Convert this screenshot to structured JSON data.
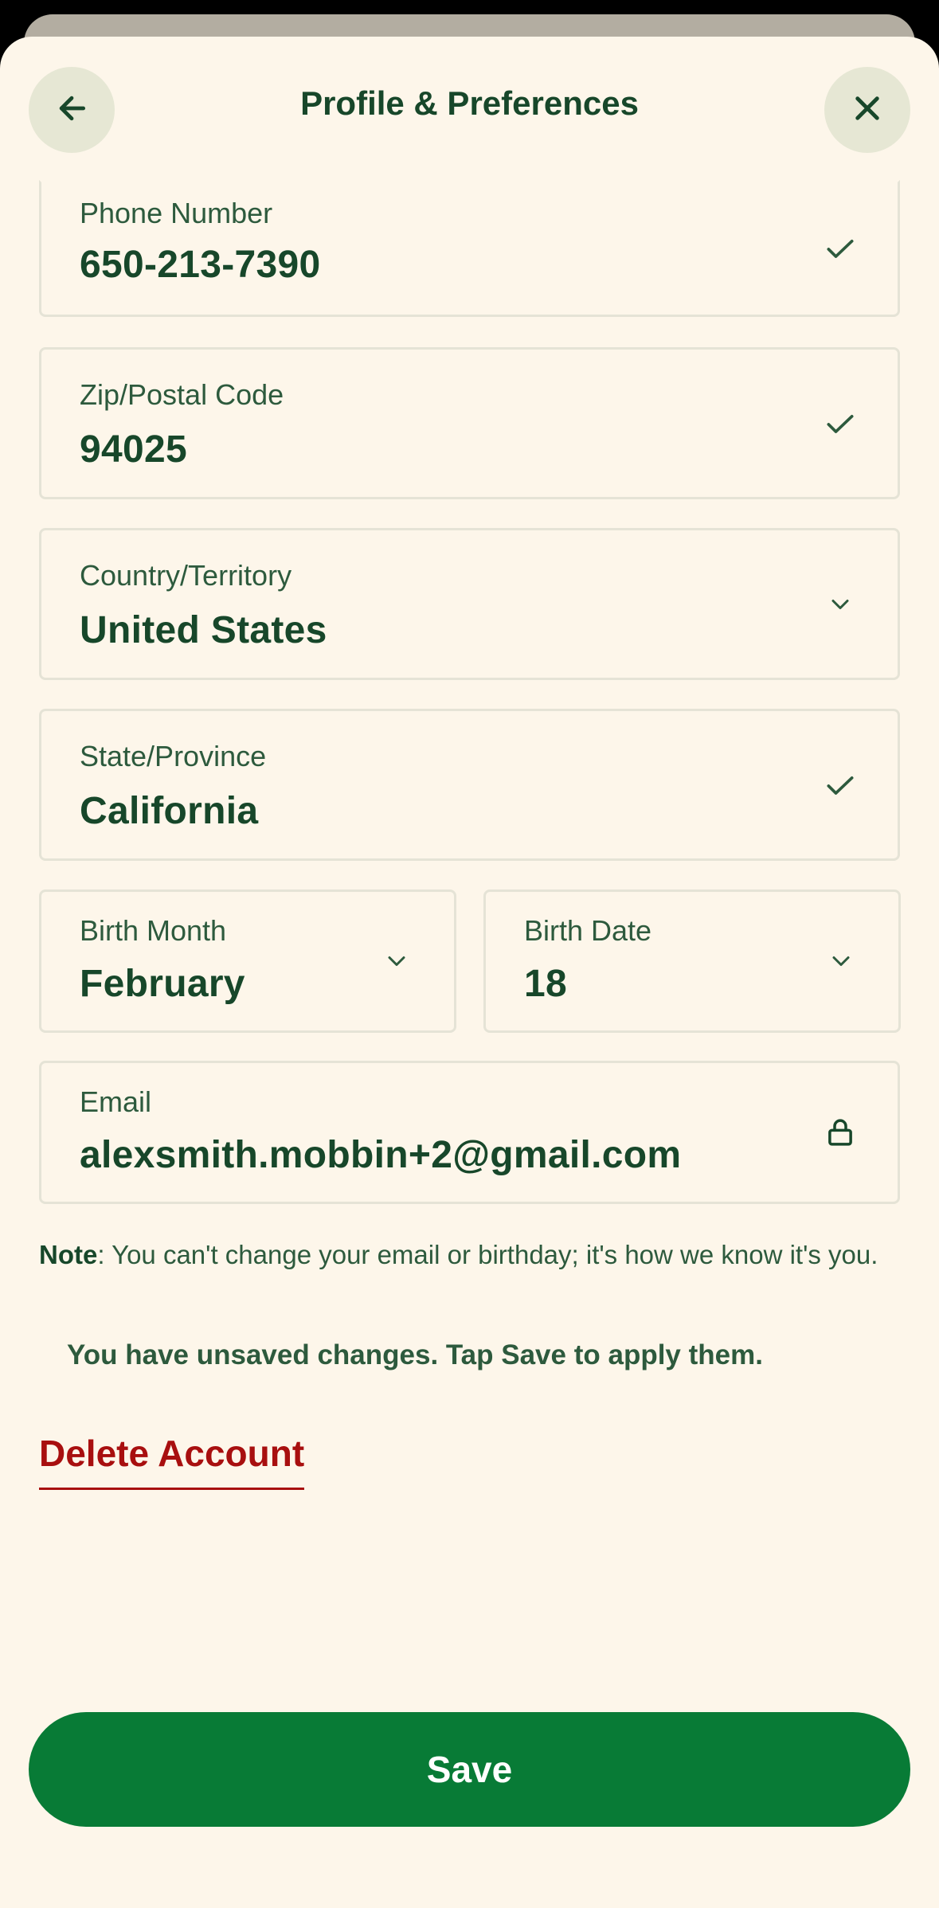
{
  "header": {
    "title": "Profile & Preferences",
    "back_icon": "arrow-left-icon",
    "close_icon": "close-icon"
  },
  "fields": {
    "phone": {
      "label": "Phone Number",
      "value": "650-213-7390",
      "icon": "check-icon"
    },
    "zip": {
      "label": "Zip/Postal Code",
      "value": "94025",
      "icon": "check-icon"
    },
    "country": {
      "label": "Country/Territory",
      "value": "United States",
      "icon": "chevron-down-icon"
    },
    "state": {
      "label": "State/Province",
      "value": "California",
      "icon": "check-icon"
    },
    "birth_month": {
      "label": "Birth Month",
      "value": "February",
      "icon": "chevron-down-icon"
    },
    "birth_date": {
      "label": "Birth Date",
      "value": "18",
      "icon": "chevron-down-icon"
    },
    "email": {
      "label": "Email",
      "value": "alexsmith.mobbin+2@gmail.com",
      "icon": "lock-icon"
    }
  },
  "note": {
    "prefix": "Note",
    "text": ": You can't change your email or birthday; it's how we know it's you."
  },
  "unsaved_message": "You have unsaved changes. Tap Save to apply them.",
  "delete_label": "Delete Account",
  "save_label": "Save",
  "colors": {
    "background": "#fdf6ea",
    "primary_text": "#17472a",
    "accent_green": "#087b36",
    "danger": "#a80f0f",
    "button_tint": "#e6e7d4"
  }
}
